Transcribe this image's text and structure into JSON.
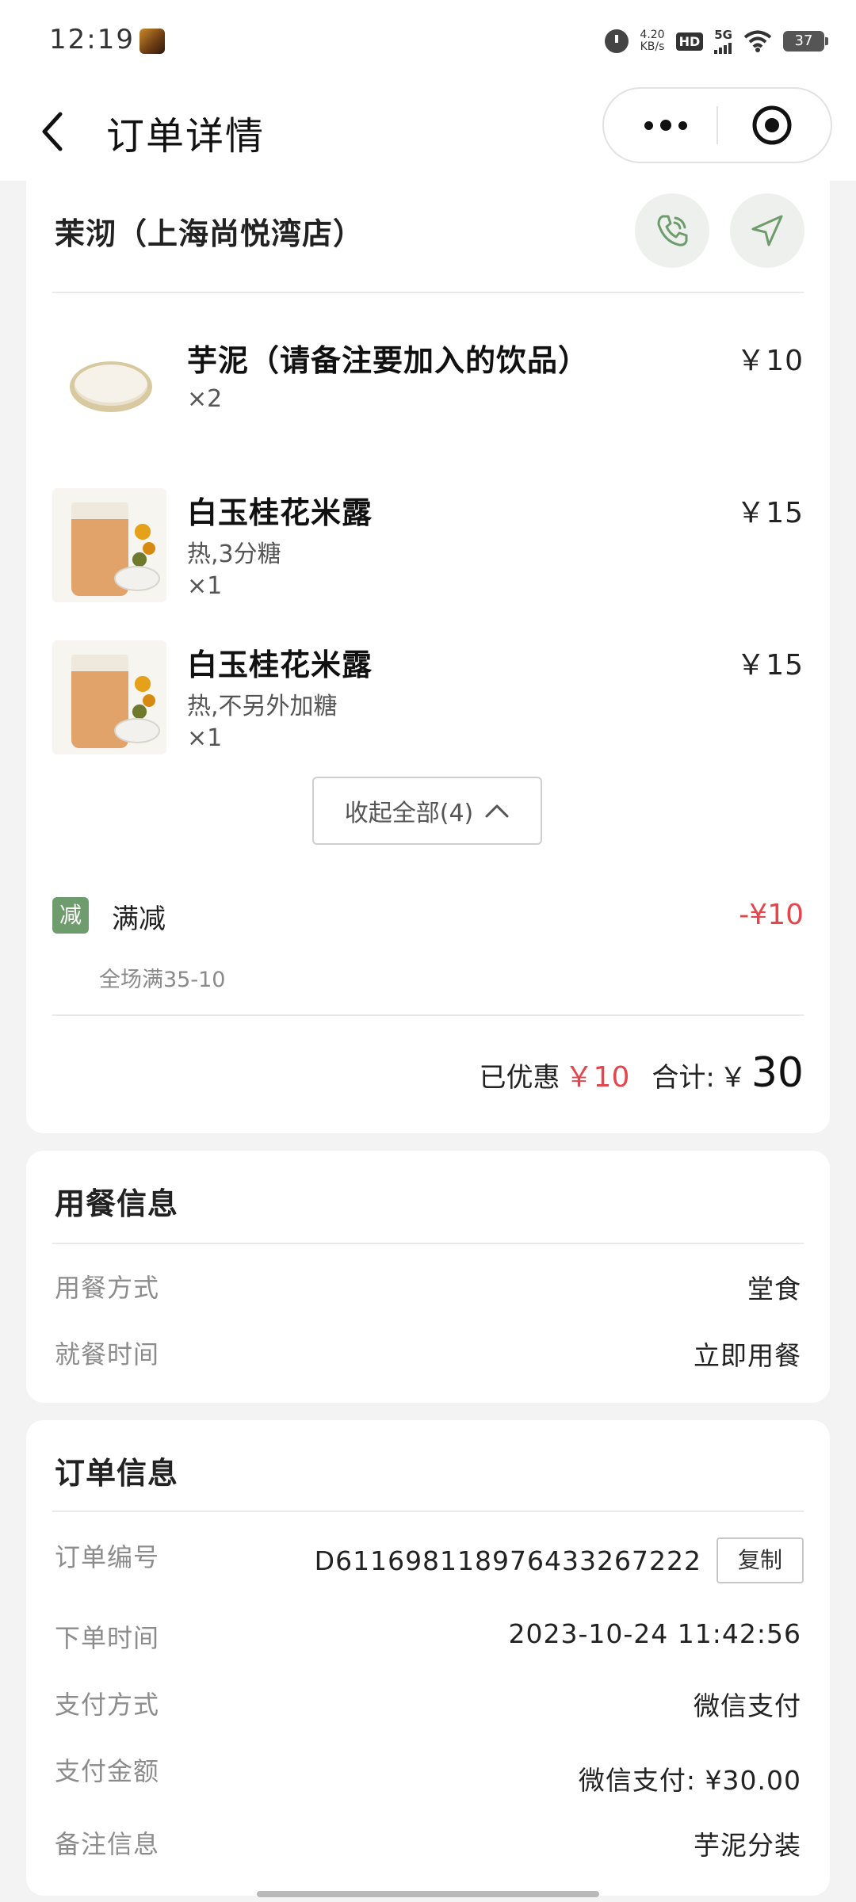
{
  "status_bar": {
    "time": "12:19",
    "net_speed_value": "4.20",
    "net_speed_unit": "KB/s",
    "hd": "HD",
    "network": "5G",
    "battery": "37"
  },
  "nav": {
    "title": "订单详情"
  },
  "store": {
    "name": "茉沏（上海尚悦湾店）"
  },
  "items": [
    {
      "name": "芋泥（请备注要加入的饮品）",
      "option": "",
      "qty": "×2",
      "price": "￥10"
    },
    {
      "name": "白玉桂花米露",
      "option": "热,3分糖",
      "qty": "×1",
      "price": "￥15"
    },
    {
      "name": "白玉桂花米露",
      "option": "热,不另外加糖",
      "qty": "×1",
      "price": "￥15"
    }
  ],
  "collapse_label": "收起全部(4)",
  "promo": {
    "tag": "减",
    "title": "满减",
    "amount": "-¥10",
    "desc": "全场满35-10"
  },
  "summary": {
    "discount_label": "已优惠",
    "discount_value": "￥10",
    "total_label": "合计:",
    "total_currency": "￥",
    "total_value": "30"
  },
  "dining": {
    "title": "用餐信息",
    "rows": [
      {
        "label": "用餐方式",
        "value": "堂食"
      },
      {
        "label": "就餐时间",
        "value": "立即用餐"
      }
    ]
  },
  "order": {
    "title": "订单信息",
    "copy_label": "复制",
    "rows": [
      {
        "label": "订单编号",
        "value": "D611698118976433267222"
      },
      {
        "label": "下单时间",
        "value": "2023-10-24 11:42:56"
      },
      {
        "label": "支付方式",
        "value": "微信支付"
      },
      {
        "label": "支付金额",
        "value": "微信支付: ¥30.00"
      },
      {
        "label": "备注信息",
        "value": "芋泥分装"
      }
    ]
  },
  "colors": {
    "accent_green": "#6f9c6d",
    "price_red": "#e5464e"
  }
}
